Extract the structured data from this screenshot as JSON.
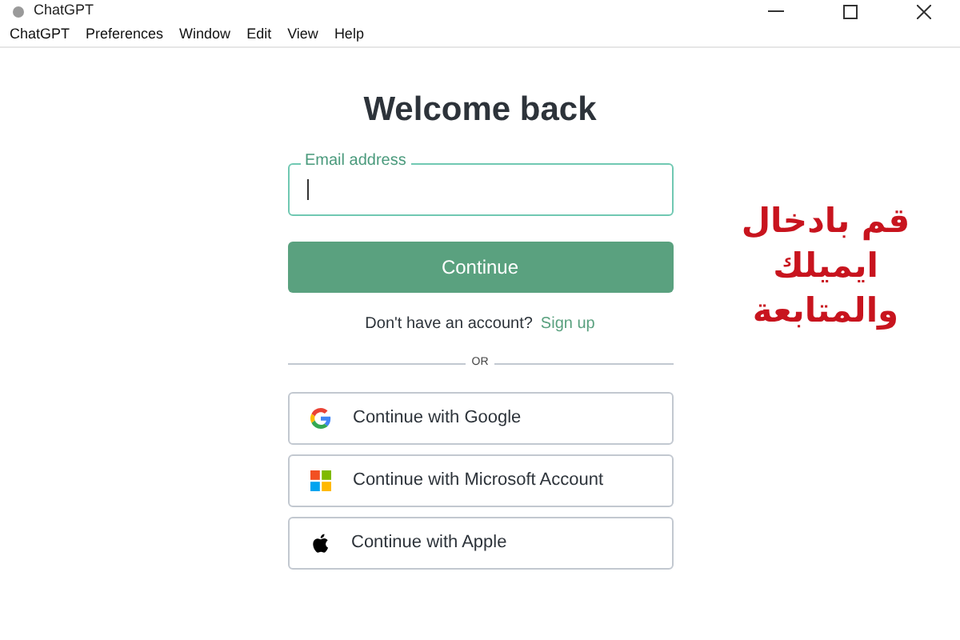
{
  "window": {
    "title": "ChatGPT"
  },
  "menu": [
    "ChatGPT",
    "Preferences",
    "Window",
    "Edit",
    "View",
    "Help"
  ],
  "heading": "Welcome back",
  "email_field": {
    "label": "Email address",
    "focused": true
  },
  "continue_button": "Continue",
  "signup": {
    "text": "Don't have an account?",
    "link": "Sign up"
  },
  "divider": "OR",
  "providers": [
    {
      "kind": "google",
      "label": "Continue with Google"
    },
    {
      "kind": "microsoft",
      "label": "Continue with Microsoft Account"
    },
    {
      "kind": "apple",
      "label": "Continue with Apple"
    }
  ],
  "annotation": [
    "قم بادخال",
    "ايميلك",
    "والمتابعة"
  ]
}
